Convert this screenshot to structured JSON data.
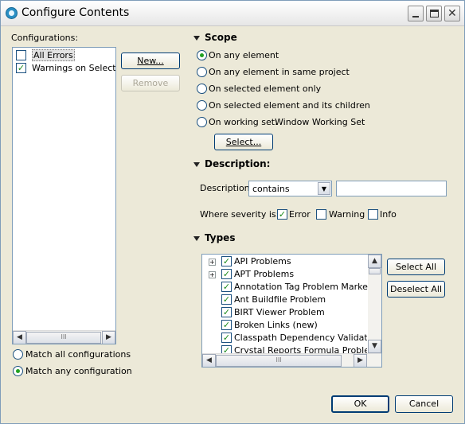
{
  "window": {
    "title": "Configure Contents",
    "minimize_glyph": "",
    "close_glyph": "✕"
  },
  "left": {
    "configurations_label": "Configurations:",
    "items": [
      {
        "label": "All Errors",
        "checked": false,
        "selected": true
      },
      {
        "label": "Warnings on Selection",
        "checked": true,
        "selected": false
      }
    ],
    "new_label": "New...",
    "remove_label": "Remove",
    "match_all_label": "Match all configurations",
    "match_any_label": "Match any configuration",
    "match_selected": "any"
  },
  "scope": {
    "heading": "Scope",
    "options": [
      {
        "label": "On any element",
        "checked": true
      },
      {
        "label": "On any element in same project",
        "checked": false
      },
      {
        "label": "On selected element only",
        "checked": false
      },
      {
        "label": "On selected element and its children",
        "checked": false
      },
      {
        "label": "On working set:",
        "checked": false
      }
    ],
    "working_set_value": "Window Working Set",
    "select_label": "Select..."
  },
  "description": {
    "heading": "Description:",
    "label": "Description",
    "operator": "contains",
    "text_value": "",
    "severity_label": "Where severity is:",
    "severity": [
      {
        "label": "Error",
        "checked": true
      },
      {
        "label": "Warning",
        "checked": false
      },
      {
        "label": "Info",
        "checked": false
      }
    ]
  },
  "types": {
    "heading": "Types",
    "items": [
      {
        "label": "API Problems",
        "expandable": true,
        "checked": true
      },
      {
        "label": "APT Problems",
        "expandable": true,
        "checked": true
      },
      {
        "label": "Annotation Tag Problem Marker",
        "expandable": false,
        "checked": true
      },
      {
        "label": "Ant Buildfile Problem",
        "expandable": false,
        "checked": true
      },
      {
        "label": "BIRT Viewer Problem",
        "expandable": false,
        "checked": true
      },
      {
        "label": "Broken Links (new)",
        "expandable": false,
        "checked": true
      },
      {
        "label": "Classpath Dependency Validator Message",
        "expandable": false,
        "checked": true
      },
      {
        "label": "Crystal Reports Formula Problem",
        "expandable": false,
        "checked": true
      }
    ],
    "select_all_label": "Select All",
    "deselect_all_label": "Deselect All"
  },
  "footer": {
    "ok_label": "OK",
    "cancel_label": "Cancel"
  },
  "icons": {
    "expander": "+",
    "scroll_left": "◀",
    "scroll_right": "▶",
    "scroll_up": "▲",
    "scroll_down": "▼",
    "thumb_grip": "III",
    "dropdown": "▼"
  }
}
